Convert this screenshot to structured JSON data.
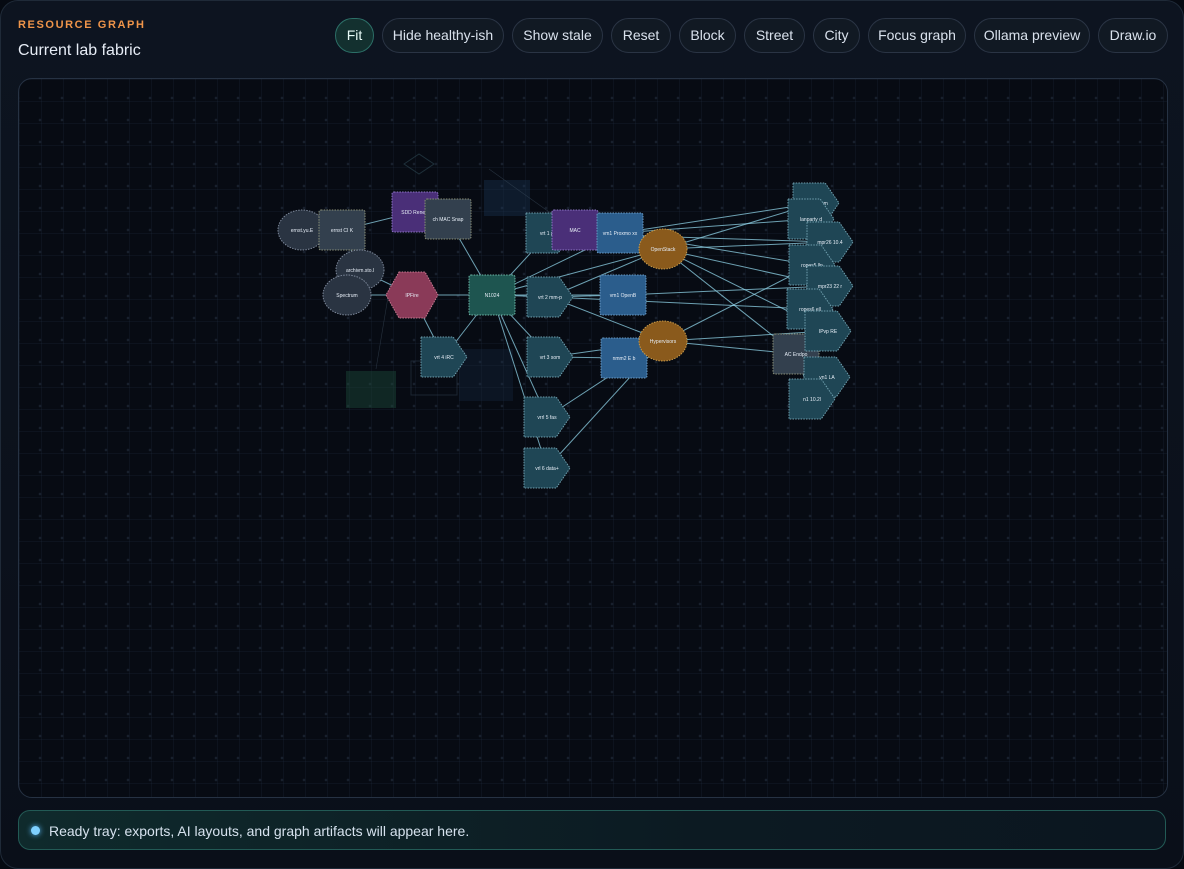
{
  "header": {
    "eyebrow": "RESOURCE GRAPH",
    "title": "Current lab fabric"
  },
  "toolbar": {
    "buttons": [
      {
        "id": "fit",
        "label": "Fit",
        "active": true
      },
      {
        "id": "hide-healthy",
        "label": "Hide healthy-ish",
        "active": false
      },
      {
        "id": "show-stale",
        "label": "Show stale",
        "active": false
      },
      {
        "id": "reset",
        "label": "Reset",
        "active": false
      },
      {
        "id": "block",
        "label": "Block",
        "active": false
      },
      {
        "id": "street",
        "label": "Street",
        "active": false
      },
      {
        "id": "city",
        "label": "City",
        "active": false
      },
      {
        "id": "focus-graph",
        "label": "Focus graph",
        "active": false
      },
      {
        "id": "ollama-preview",
        "label": "Ollama preview",
        "active": false
      },
      {
        "id": "drawio",
        "label": "Draw.io",
        "active": false
      }
    ]
  },
  "graph": {
    "colors": {
      "edge": "#8fd3e8",
      "host": "#2a3442",
      "switch": "#1e5550",
      "vm": "#2b5d8c",
      "vlan": "#1f4655",
      "cluster": "#8a5a1c",
      "firewall": "#8a3a58",
      "service": "#4a2f78",
      "device": "#33404e"
    },
    "nodes": [
      {
        "id": "n1",
        "shape": "ellipse",
        "kind": "host",
        "label": "ernst.yu.E"
      },
      {
        "id": "n2",
        "shape": "rect",
        "kind": "device",
        "label": "ernst CI K"
      },
      {
        "id": "n3",
        "shape": "ellipse",
        "kind": "host",
        "label": "archivm.sto.l"
      },
      {
        "id": "n4",
        "shape": "ellipse",
        "kind": "host",
        "label": "Spectrum"
      },
      {
        "id": "n5",
        "shape": "rect",
        "kind": "service",
        "label": "SDD Renew"
      },
      {
        "id": "n6",
        "shape": "rect",
        "kind": "device",
        "label": "ch MAC Snap"
      },
      {
        "id": "n7",
        "shape": "hexagon",
        "kind": "firewall",
        "label": "IPFire"
      },
      {
        "id": "n8",
        "shape": "rect",
        "kind": "switch",
        "label": "N1024"
      },
      {
        "id": "n9",
        "shape": "pentagon",
        "kind": "vlan",
        "label": "vrt 1 p-p"
      },
      {
        "id": "n10",
        "shape": "rect",
        "kind": "service",
        "label": "MAC"
      },
      {
        "id": "n11",
        "shape": "rect",
        "kind": "vm",
        "label": "vm1 Proxmo xx"
      },
      {
        "id": "n12",
        "shape": "ellipse",
        "kind": "cluster",
        "label": "OpenStack"
      },
      {
        "id": "n13",
        "shape": "pentagon",
        "kind": "vlan",
        "label": "vrt 2 mm-p"
      },
      {
        "id": "n14",
        "shape": "rect",
        "kind": "vm",
        "label": "vm1 OpenB"
      },
      {
        "id": "n15",
        "shape": "pentagon",
        "kind": "vlan",
        "label": "vrt 4 iRC"
      },
      {
        "id": "n16",
        "shape": "pentagon",
        "kind": "vlan",
        "label": "vrt 3 som"
      },
      {
        "id": "n17",
        "shape": "rect",
        "kind": "vm",
        "label": "nmm2 E b"
      },
      {
        "id": "n18",
        "shape": "ellipse",
        "kind": "cluster",
        "label": "Hypervisors"
      },
      {
        "id": "n19",
        "shape": "pentagon",
        "kind": "vlan",
        "label": "vrrl 5 fas"
      },
      {
        "id": "n20",
        "shape": "pentagon",
        "kind": "vlan",
        "label": "vrl 6 data+"
      },
      {
        "id": "n21",
        "shape": "rect",
        "kind": "device",
        "label": "AC Endpo"
      },
      {
        "id": "n22",
        "shape": "pentagon",
        "kind": "vlan",
        "label": "gaurd.com"
      },
      {
        "id": "n23",
        "shape": "pentagon",
        "kind": "vlan",
        "label": "lanparty d"
      },
      {
        "id": "n24",
        "shape": "pentagon",
        "kind": "vlan",
        "label": "mpr26 10.4"
      },
      {
        "id": "n25",
        "shape": "pentagon",
        "kind": "vlan",
        "label": "ropes5.lln"
      },
      {
        "id": "n26",
        "shape": "pentagon",
        "kind": "vlan",
        "label": "mpr23 22 r"
      },
      {
        "id": "n27",
        "shape": "pentagon",
        "kind": "vlan",
        "label": "ropes6 ell"
      },
      {
        "id": "n28",
        "shape": "pentagon",
        "kind": "vlan",
        "label": "IPvp RE"
      },
      {
        "id": "n29",
        "shape": "pentagon",
        "kind": "vlan",
        "label": "vn1 LA"
      },
      {
        "id": "n30",
        "shape": "pentagon",
        "kind": "vlan",
        "label": "n1 10.2l"
      }
    ],
    "edges": [
      [
        "n1",
        "n2"
      ],
      [
        "n2",
        "n5"
      ],
      [
        "n2",
        "n3"
      ],
      [
        "n3",
        "n4"
      ],
      [
        "n4",
        "n7"
      ],
      [
        "n3",
        "n7"
      ],
      [
        "n5",
        "n6"
      ],
      [
        "n6",
        "n8"
      ],
      [
        "n7",
        "n8"
      ],
      [
        "n7",
        "n15"
      ],
      [
        "n8",
        "n9"
      ],
      [
        "n8",
        "n13"
      ],
      [
        "n8",
        "n16"
      ],
      [
        "n8",
        "n19"
      ],
      [
        "n8",
        "n20"
      ],
      [
        "n8",
        "n11"
      ],
      [
        "n8",
        "n12"
      ],
      [
        "n8",
        "n14"
      ],
      [
        "n8",
        "n15"
      ],
      [
        "n9",
        "n10"
      ],
      [
        "n10",
        "n11"
      ],
      [
        "n11",
        "n12"
      ],
      [
        "n13",
        "n14"
      ],
      [
        "n13",
        "n18"
      ],
      [
        "n16",
        "n17"
      ],
      [
        "n17",
        "n18"
      ],
      [
        "n18",
        "n21"
      ],
      [
        "n12",
        "n21"
      ],
      [
        "n12",
        "n24"
      ],
      [
        "n12",
        "n26"
      ],
      [
        "n11",
        "n22"
      ],
      [
        "n11",
        "n23"
      ],
      [
        "n11",
        "n25"
      ],
      [
        "n9",
        "n24"
      ],
      [
        "n13",
        "n27"
      ],
      [
        "n14",
        "n26"
      ],
      [
        "n18",
        "n28"
      ],
      [
        "n19",
        "n18"
      ],
      [
        "n20",
        "n18"
      ],
      [
        "n12",
        "n28"
      ],
      [
        "n21",
        "n29"
      ],
      [
        "n21",
        "n30"
      ],
      [
        "n9",
        "n12"
      ],
      [
        "n16",
        "n18"
      ],
      [
        "n13",
        "n12"
      ],
      [
        "n18",
        "n25"
      ],
      [
        "n12",
        "n22"
      ]
    ]
  },
  "tray": {
    "message": "Ready tray: exports, AI layouts, and graph artifacts will appear here."
  }
}
